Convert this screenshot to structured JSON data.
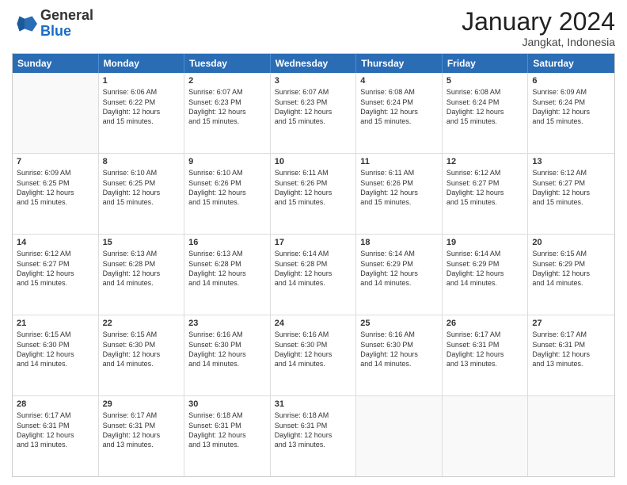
{
  "header": {
    "logo_general": "General",
    "logo_blue": "Blue",
    "month_title": "January 2024",
    "subtitle": "Jangkat, Indonesia"
  },
  "days_of_week": [
    "Sunday",
    "Monday",
    "Tuesday",
    "Wednesday",
    "Thursday",
    "Friday",
    "Saturday"
  ],
  "weeks": [
    [
      {
        "day": "",
        "empty": true
      },
      {
        "day": "1",
        "sunrise": "6:06 AM",
        "sunset": "6:22 PM",
        "daylight": "12 hours and 15 minutes."
      },
      {
        "day": "2",
        "sunrise": "6:07 AM",
        "sunset": "6:23 PM",
        "daylight": "12 hours and 15 minutes."
      },
      {
        "day": "3",
        "sunrise": "6:07 AM",
        "sunset": "6:23 PM",
        "daylight": "12 hours and 15 minutes."
      },
      {
        "day": "4",
        "sunrise": "6:08 AM",
        "sunset": "6:24 PM",
        "daylight": "12 hours and 15 minutes."
      },
      {
        "day": "5",
        "sunrise": "6:08 AM",
        "sunset": "6:24 PM",
        "daylight": "12 hours and 15 minutes."
      },
      {
        "day": "6",
        "sunrise": "6:09 AM",
        "sunset": "6:24 PM",
        "daylight": "12 hours and 15 minutes."
      }
    ],
    [
      {
        "day": "7",
        "sunrise": "6:09 AM",
        "sunset": "6:25 PM",
        "daylight": "12 hours and 15 minutes."
      },
      {
        "day": "8",
        "sunrise": "6:10 AM",
        "sunset": "6:25 PM",
        "daylight": "12 hours and 15 minutes."
      },
      {
        "day": "9",
        "sunrise": "6:10 AM",
        "sunset": "6:26 PM",
        "daylight": "12 hours and 15 minutes."
      },
      {
        "day": "10",
        "sunrise": "6:11 AM",
        "sunset": "6:26 PM",
        "daylight": "12 hours and 15 minutes."
      },
      {
        "day": "11",
        "sunrise": "6:11 AM",
        "sunset": "6:26 PM",
        "daylight": "12 hours and 15 minutes."
      },
      {
        "day": "12",
        "sunrise": "6:12 AM",
        "sunset": "6:27 PM",
        "daylight": "12 hours and 15 minutes."
      },
      {
        "day": "13",
        "sunrise": "6:12 AM",
        "sunset": "6:27 PM",
        "daylight": "12 hours and 15 minutes."
      }
    ],
    [
      {
        "day": "14",
        "sunrise": "6:12 AM",
        "sunset": "6:27 PM",
        "daylight": "12 hours and 15 minutes."
      },
      {
        "day": "15",
        "sunrise": "6:13 AM",
        "sunset": "6:28 PM",
        "daylight": "12 hours and 14 minutes."
      },
      {
        "day": "16",
        "sunrise": "6:13 AM",
        "sunset": "6:28 PM",
        "daylight": "12 hours and 14 minutes."
      },
      {
        "day": "17",
        "sunrise": "6:14 AM",
        "sunset": "6:28 PM",
        "daylight": "12 hours and 14 minutes."
      },
      {
        "day": "18",
        "sunrise": "6:14 AM",
        "sunset": "6:29 PM",
        "daylight": "12 hours and 14 minutes."
      },
      {
        "day": "19",
        "sunrise": "6:14 AM",
        "sunset": "6:29 PM",
        "daylight": "12 hours and 14 minutes."
      },
      {
        "day": "20",
        "sunrise": "6:15 AM",
        "sunset": "6:29 PM",
        "daylight": "12 hours and 14 minutes."
      }
    ],
    [
      {
        "day": "21",
        "sunrise": "6:15 AM",
        "sunset": "6:30 PM",
        "daylight": "12 hours and 14 minutes."
      },
      {
        "day": "22",
        "sunrise": "6:15 AM",
        "sunset": "6:30 PM",
        "daylight": "12 hours and 14 minutes."
      },
      {
        "day": "23",
        "sunrise": "6:16 AM",
        "sunset": "6:30 PM",
        "daylight": "12 hours and 14 minutes."
      },
      {
        "day": "24",
        "sunrise": "6:16 AM",
        "sunset": "6:30 PM",
        "daylight": "12 hours and 14 minutes."
      },
      {
        "day": "25",
        "sunrise": "6:16 AM",
        "sunset": "6:30 PM",
        "daylight": "12 hours and 14 minutes."
      },
      {
        "day": "26",
        "sunrise": "6:17 AM",
        "sunset": "6:31 PM",
        "daylight": "12 hours and 13 minutes."
      },
      {
        "day": "27",
        "sunrise": "6:17 AM",
        "sunset": "6:31 PM",
        "daylight": "12 hours and 13 minutes."
      }
    ],
    [
      {
        "day": "28",
        "sunrise": "6:17 AM",
        "sunset": "6:31 PM",
        "daylight": "12 hours and 13 minutes."
      },
      {
        "day": "29",
        "sunrise": "6:17 AM",
        "sunset": "6:31 PM",
        "daylight": "12 hours and 13 minutes."
      },
      {
        "day": "30",
        "sunrise": "6:18 AM",
        "sunset": "6:31 PM",
        "daylight": "12 hours and 13 minutes."
      },
      {
        "day": "31",
        "sunrise": "6:18 AM",
        "sunset": "6:31 PM",
        "daylight": "12 hours and 13 minutes."
      },
      {
        "day": "",
        "empty": true
      },
      {
        "day": "",
        "empty": true
      },
      {
        "day": "",
        "empty": true
      }
    ]
  ],
  "labels": {
    "sunrise_prefix": "Sunrise: ",
    "sunset_prefix": "Sunset: ",
    "daylight_prefix": "Daylight: "
  }
}
